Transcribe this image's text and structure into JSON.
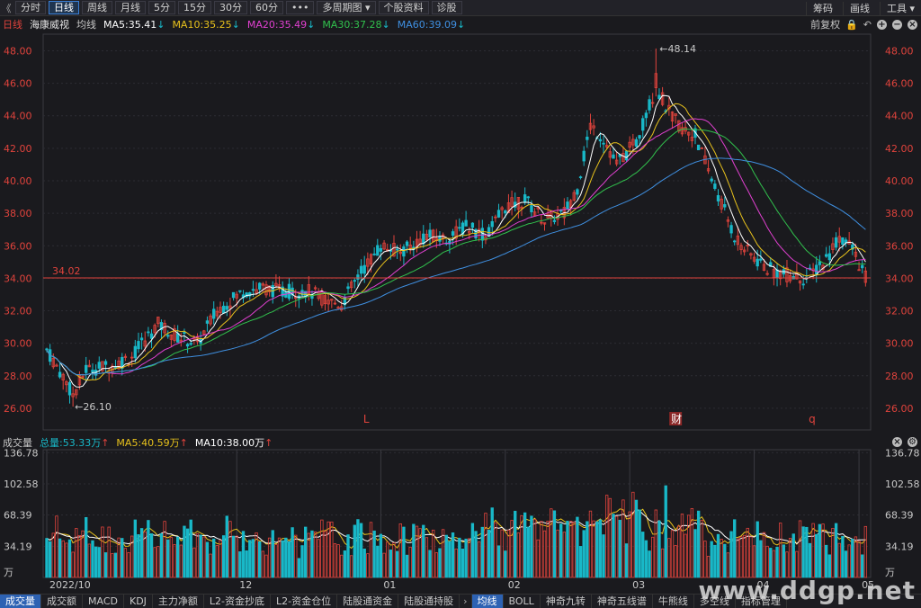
{
  "toolbar": {
    "back_glyph": "《",
    "periods": [
      "分时",
      "日线",
      "周线",
      "月线",
      "5分",
      "15分",
      "30分",
      "60分"
    ],
    "active_period": "日线",
    "more": "•••",
    "multi_period": "多周期图 ▾",
    "stock_info": "个股资料",
    "diagnose": "诊股",
    "right": [
      "筹码",
      "画线",
      "工具 ▾"
    ]
  },
  "info": {
    "period": "日线",
    "stock_name": "海康威视",
    "ma_label": "均线",
    "ma5": "MA5:35.41",
    "ma10": "MA10:35.25",
    "ma20": "MA20:35.49",
    "ma30": "MA30:37.28",
    "ma60": "MA60:39.09",
    "adjust": "前复权",
    "colors": {
      "ma5": "#ffffff",
      "ma10": "#e8c21c",
      "ma20": "#e040d0",
      "ma30": "#31c14d",
      "ma60": "#3f8fe0"
    }
  },
  "volume_header": {
    "title": "成交量",
    "total": "总量:53.33万",
    "ma5": "MA5:40.59万",
    "ma10": "MA10:38.00万"
  },
  "chart_data": {
    "type": "candlestick",
    "y_ticks": [
      "48.00",
      "46.00",
      "44.00",
      "42.00",
      "40.00",
      "38.00",
      "36.00",
      "34.00",
      "32.00",
      "30.00",
      "28.00",
      "26.00"
    ],
    "ylim": [
      25.0,
      48.8
    ],
    "current_price_line": "34.02",
    "current_price": 34.02,
    "max_label": "48.14",
    "min_label": "26.10",
    "x_ticks": [
      "2022/10",
      "12",
      "01",
      "02",
      "03",
      "04",
      "05"
    ],
    "markers": [
      "L",
      "财",
      "q"
    ],
    "volume_y_ticks": [
      "136.78",
      "102.58",
      "68.39",
      "34.19",
      "万"
    ],
    "volume_ylim": [
      0,
      140
    ],
    "up_color": "#e0433c",
    "down_color": "#19b8c8"
  },
  "bottom_tabs": [
    "成交量",
    "成交额",
    "MACD",
    "KDJ",
    "主力净额",
    "L2-资金抄底",
    "L2-资金仓位",
    "陆股通资金",
    "陆股通持股",
    "›",
    "均线",
    "BOLL",
    "神奇九转",
    "神奇五线谱",
    "牛熊线",
    "多空线",
    "指标管理"
  ],
  "active_bottom_tab": "均线",
  "watermark": "www.ddgp.net"
}
